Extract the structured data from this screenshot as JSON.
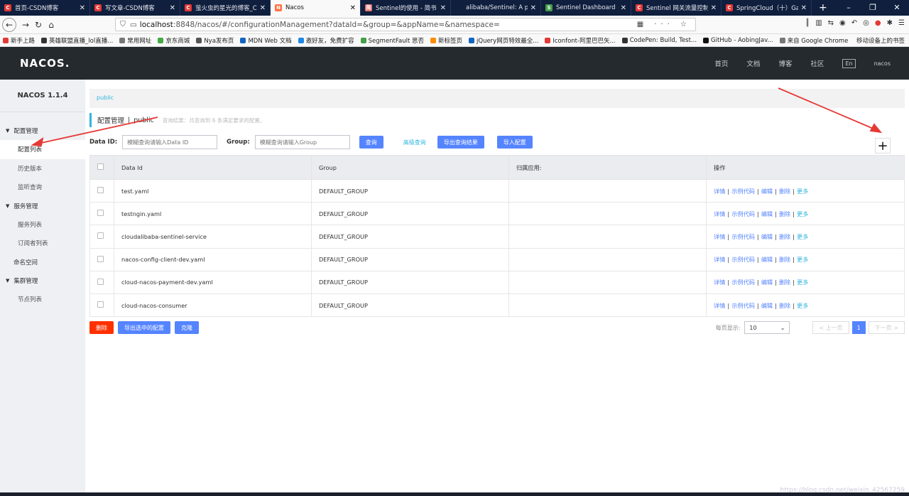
{
  "browser": {
    "tabs": [
      {
        "title": "首页-CSDN博客",
        "icon_color": "#e53935",
        "icon": "C"
      },
      {
        "title": "写文章-CSDN博客",
        "icon_color": "#e53935",
        "icon": "C"
      },
      {
        "title": "萤火虫的星光的博客_CS",
        "icon_color": "#e53935",
        "icon": "C"
      },
      {
        "title": "Nacos",
        "icon_color": "#ff7043",
        "icon": "N",
        "active": true
      },
      {
        "title": "Sentinel的使用 - 简书",
        "icon_color": "#e57373",
        "icon": "简"
      },
      {
        "title": "alibaba/Sentinel: A p",
        "icon_color": "#0f1f3d",
        "icon": ""
      },
      {
        "title": "Sentinel Dashboard",
        "icon_color": "#43a047",
        "icon": "S"
      },
      {
        "title": "Sentinel 网关流量控制",
        "icon_color": "#e53935",
        "icon": "C"
      },
      {
        "title": "SpringCloud（十）Ga",
        "icon_color": "#e53935",
        "icon": "C"
      }
    ],
    "url_host": "localhost",
    "url_rest": ":8848/nacos/#/configurationManagement?dataId=&group=&appName=&namespace=",
    "bookmarks": [
      "新手上路",
      "英雄联盟直播_lol直播...",
      "常用网址",
      "京东商城",
      "Nya发布页",
      "MDN Web 文档",
      "邀好友，免费扩容",
      "SegmentFault 思否",
      "新标签页",
      "jQuery网页特效最全...",
      "Iconfont-阿里巴巴矢...",
      "CodePen: Build, Test...",
      "GitHub - AobingJav...",
      "来自 Google Chrome"
    ],
    "bookmarks_right": "移动设备上的书签"
  },
  "header": {
    "logo": "NACOS.",
    "nav": [
      "首页",
      "文档",
      "博客",
      "社区"
    ],
    "lang": "En",
    "user": "nacos"
  },
  "sidebar": {
    "title": "NACOS 1.1.4",
    "groups": [
      {
        "label": "配置管理",
        "items": [
          "配置列表",
          "历史版本",
          "监听查询"
        ]
      },
      {
        "label": "服务管理",
        "items": [
          "服务列表",
          "订阅者列表"
        ]
      }
    ],
    "namespace": "命名空间",
    "cluster": {
      "label": "集群管理",
      "items": [
        "节点列表"
      ]
    }
  },
  "main": {
    "breadcrumb": "public",
    "title": "配置管理",
    "title_sep": "|",
    "namespace": "public",
    "hint": "查询结果：共查询到 6 条满足要求的配置。",
    "search": {
      "dataid_label": "Data ID:",
      "dataid_placeholder": "模糊查询请输入Data ID",
      "group_label": "Group:",
      "group_placeholder": "模糊查询请输入Group",
      "query": "查询",
      "advanced": "高级查询",
      "export": "导出查询结果",
      "import": "导入配置"
    },
    "columns": [
      "Data Id",
      "Group",
      "归属应用:",
      "操作"
    ],
    "rows": [
      {
        "data_id": "test.yaml",
        "group": "DEFAULT_GROUP",
        "app": ""
      },
      {
        "data_id": "testngin.yaml",
        "group": "DEFAULT_GROUP",
        "app": ""
      },
      {
        "data_id": "cloudalibaba-sentinel-service",
        "group": "DEFAULT_GROUP",
        "app": ""
      },
      {
        "data_id": "nacos-config-client-dev.yaml",
        "group": "DEFAULT_GROUP",
        "app": ""
      },
      {
        "data_id": "cloud-nacos-payment-dev.yaml",
        "group": "DEFAULT_GROUP",
        "app": ""
      },
      {
        "data_id": "cloud-nacos-consumer",
        "group": "DEFAULT_GROUP",
        "app": ""
      }
    ],
    "ops": [
      "详情",
      "示例代码",
      "编辑",
      "删除",
      "更多"
    ],
    "bottom": {
      "delete": "删除",
      "export_selected": "导出选中的配置",
      "clone": "克隆"
    },
    "pager": {
      "page_size_label": "每页显示:",
      "page_size": "10",
      "prev": "< 上一页",
      "current": "1",
      "next": "下一页 >"
    }
  },
  "watermark": "https://blog.csdn.net/weixin_42567259"
}
